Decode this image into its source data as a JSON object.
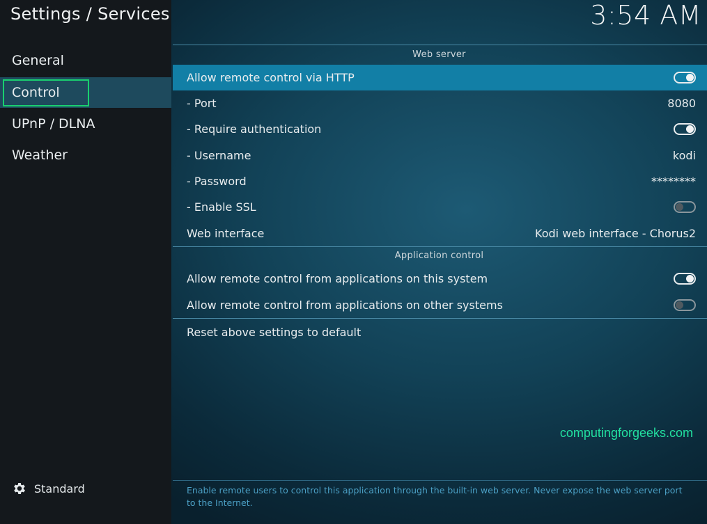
{
  "header": {
    "title": "Settings / Services",
    "clock": "3:54 AM"
  },
  "sidebar": {
    "items": [
      {
        "label": "General"
      },
      {
        "label": "Control"
      },
      {
        "label": "UPnP / DLNA"
      },
      {
        "label": "Weather"
      }
    ],
    "profile_label": "Standard",
    "profile_icon": "gear-icon"
  },
  "web_server": {
    "header": "Web server",
    "allow_http": {
      "label": "Allow remote control via HTTP",
      "enabled": true
    },
    "port": {
      "label": "- Port",
      "value": "8080"
    },
    "require_auth": {
      "label": "- Require authentication",
      "enabled": true
    },
    "username": {
      "label": "- Username",
      "value": "kodi"
    },
    "password": {
      "label": "- Password",
      "value": "********"
    },
    "ssl": {
      "label": "- Enable SSL",
      "enabled": false
    },
    "web_interface": {
      "label": "Web interface",
      "value": "Kodi web interface - Chorus2"
    }
  },
  "app_control": {
    "header": "Application control",
    "this_system": {
      "label": "Allow remote control from applications on this system",
      "enabled": true
    },
    "other_systems": {
      "label": "Allow remote control from applications on other systems",
      "enabled": false
    }
  },
  "reset_label": "Reset above settings to default",
  "watermark": "computingforgeeks.com",
  "help_text": "Enable remote users to control this application through the built-in web server. Never expose the web server port to the Internet.",
  "colors": {
    "accent": "#127fa6",
    "focus_border": "#19d06f",
    "watermark": "#22e0a0"
  }
}
